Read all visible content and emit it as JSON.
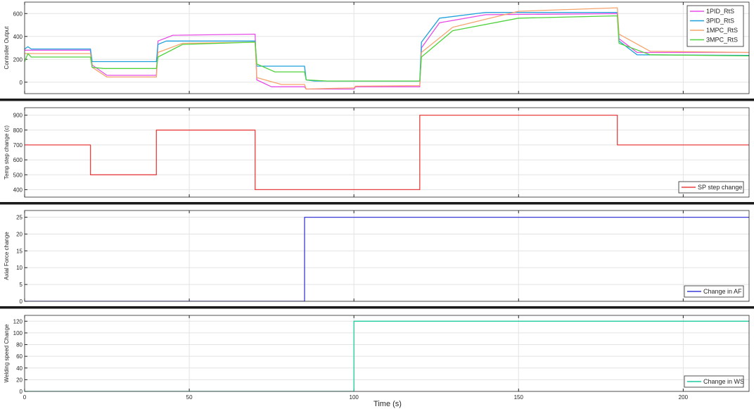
{
  "x_axis": {
    "label": "Time (s)",
    "range": [
      0,
      220
    ],
    "ticks": [
      0,
      50,
      100,
      150,
      200
    ]
  },
  "colors": {
    "pid1": "#e64ee6",
    "pid3": "#1ea0dc",
    "mpc1": "#f5a56e",
    "mpc3": "#4fd23c",
    "sp": "#e84040",
    "af": "#3a3ad8",
    "ws": "#1ccca0",
    "grid": "#e3e3e3",
    "divider": "#1a1a1a"
  },
  "chart_data": [
    {
      "type": "line",
      "ylabel": "Controller Output",
      "xlim": [
        0,
        220
      ],
      "ylim": [
        -100,
        700
      ],
      "yticks": [
        0,
        200,
        400,
        600
      ],
      "grid": true,
      "legend": "top-right",
      "series": [
        {
          "name": "1PID_RtS",
          "color_key": "pid1",
          "x": [
            0,
            20,
            20.5,
            25,
            40,
            40.5,
            45,
            70,
            70.5,
            75,
            85,
            85.5,
            90,
            100,
            100.5,
            120,
            120.5,
            126,
            140,
            180,
            180.5,
            186,
            220
          ],
          "y": [
            280,
            280,
            150,
            60,
            60,
            360,
            410,
            420,
            20,
            -40,
            -40,
            -60,
            -60,
            -60,
            -40,
            -40,
            300,
            520,
            590,
            600,
            380,
            260,
            260
          ]
        },
        {
          "name": "3PID_RtS",
          "color_key": "pid3",
          "x": [
            0,
            1,
            2,
            20,
            20.5,
            40,
            40.5,
            43,
            70,
            70.5,
            73,
            85,
            85.5,
            88,
            100,
            120,
            120.5,
            126,
            140,
            180,
            180.5,
            186,
            220
          ],
          "y": [
            290,
            310,
            290,
            290,
            180,
            180,
            330,
            360,
            360,
            140,
            140,
            140,
            20,
            10,
            10,
            10,
            350,
            560,
            610,
            610,
            360,
            240,
            235
          ]
        },
        {
          "name": "1MPC_RtS",
          "color_key": "mpc1",
          "x": [
            0,
            20,
            20.5,
            25,
            40,
            40.5,
            48,
            70,
            70.5,
            78,
            85,
            85.5,
            92,
            100,
            100.5,
            120,
            120.5,
            130,
            150,
            180,
            180.5,
            190,
            220
          ],
          "y": [
            250,
            250,
            130,
            45,
            45,
            260,
            340,
            350,
            40,
            -20,
            -20,
            -60,
            -55,
            -50,
            -35,
            -30,
            260,
            480,
            620,
            650,
            420,
            270,
            260
          ]
        },
        {
          "name": "3MPC_RtS",
          "color_key": "mpc3",
          "x": [
            0,
            1,
            2,
            20,
            20.5,
            24,
            40,
            40.5,
            48,
            70,
            70.5,
            76,
            85,
            85.5,
            92,
            100,
            120,
            120.5,
            130,
            150,
            180,
            180.5,
            190,
            220
          ],
          "y": [
            180,
            250,
            220,
            220,
            130,
            120,
            120,
            220,
            330,
            350,
            160,
            90,
            90,
            20,
            10,
            10,
            10,
            220,
            450,
            560,
            580,
            340,
            240,
            230
          ]
        }
      ]
    },
    {
      "type": "line",
      "ylabel": "Temp step change (c)",
      "xlim": [
        0,
        220
      ],
      "ylim": [
        350,
        950
      ],
      "yticks": [
        400,
        500,
        600,
        700,
        800,
        900
      ],
      "grid": true,
      "legend": "bottom-right",
      "series": [
        {
          "name": "SP step change",
          "color_key": "sp",
          "x": [
            0,
            20,
            20,
            40,
            40,
            70,
            70,
            120,
            120,
            180,
            180,
            220
          ],
          "y": [
            700,
            700,
            500,
            500,
            800,
            800,
            400,
            400,
            900,
            900,
            700,
            700
          ]
        }
      ]
    },
    {
      "type": "line",
      "ylabel": "Axial Force change",
      "xlim": [
        0,
        220
      ],
      "ylim": [
        0,
        27
      ],
      "yticks": [
        0,
        5,
        10,
        15,
        20,
        25
      ],
      "grid": true,
      "legend": "bottom-right",
      "series": [
        {
          "name": "Change in AF",
          "color_key": "af",
          "x": [
            0,
            85,
            85,
            220
          ],
          "y": [
            0,
            0,
            25,
            25
          ]
        }
      ]
    },
    {
      "type": "line",
      "ylabel": "Welding speed Change",
      "xlim": [
        0,
        220
      ],
      "ylim": [
        0,
        130
      ],
      "yticks": [
        0,
        20,
        40,
        60,
        80,
        100,
        120
      ],
      "grid": true,
      "legend": "bottom-right",
      "series": [
        {
          "name": "Change in WS",
          "color_key": "ws",
          "x": [
            0,
            100,
            100,
            220
          ],
          "y": [
            0,
            0,
            120,
            120
          ]
        }
      ]
    }
  ]
}
